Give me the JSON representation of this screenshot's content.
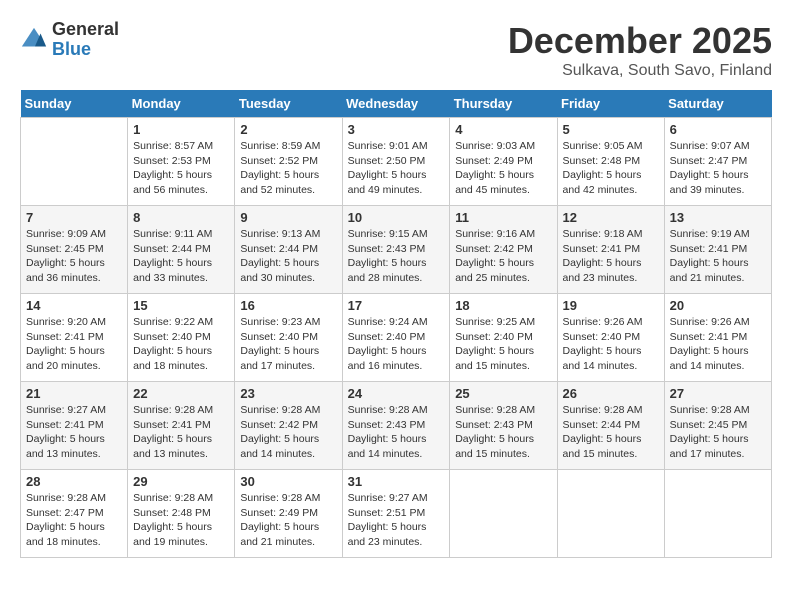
{
  "logo": {
    "general": "General",
    "blue": "Blue"
  },
  "title": "December 2025",
  "location": "Sulkava, South Savo, Finland",
  "header": {
    "days": [
      "Sunday",
      "Monday",
      "Tuesday",
      "Wednesday",
      "Thursday",
      "Friday",
      "Saturday"
    ]
  },
  "weeks": [
    [
      {
        "day": "",
        "info": ""
      },
      {
        "day": "1",
        "info": "Sunrise: 8:57 AM\nSunset: 2:53 PM\nDaylight: 5 hours\nand 56 minutes."
      },
      {
        "day": "2",
        "info": "Sunrise: 8:59 AM\nSunset: 2:52 PM\nDaylight: 5 hours\nand 52 minutes."
      },
      {
        "day": "3",
        "info": "Sunrise: 9:01 AM\nSunset: 2:50 PM\nDaylight: 5 hours\nand 49 minutes."
      },
      {
        "day": "4",
        "info": "Sunrise: 9:03 AM\nSunset: 2:49 PM\nDaylight: 5 hours\nand 45 minutes."
      },
      {
        "day": "5",
        "info": "Sunrise: 9:05 AM\nSunset: 2:48 PM\nDaylight: 5 hours\nand 42 minutes."
      },
      {
        "day": "6",
        "info": "Sunrise: 9:07 AM\nSunset: 2:47 PM\nDaylight: 5 hours\nand 39 minutes."
      }
    ],
    [
      {
        "day": "7",
        "info": "Sunrise: 9:09 AM\nSunset: 2:45 PM\nDaylight: 5 hours\nand 36 minutes."
      },
      {
        "day": "8",
        "info": "Sunrise: 9:11 AM\nSunset: 2:44 PM\nDaylight: 5 hours\nand 33 minutes."
      },
      {
        "day": "9",
        "info": "Sunrise: 9:13 AM\nSunset: 2:44 PM\nDaylight: 5 hours\nand 30 minutes."
      },
      {
        "day": "10",
        "info": "Sunrise: 9:15 AM\nSunset: 2:43 PM\nDaylight: 5 hours\nand 28 minutes."
      },
      {
        "day": "11",
        "info": "Sunrise: 9:16 AM\nSunset: 2:42 PM\nDaylight: 5 hours\nand 25 minutes."
      },
      {
        "day": "12",
        "info": "Sunrise: 9:18 AM\nSunset: 2:41 PM\nDaylight: 5 hours\nand 23 minutes."
      },
      {
        "day": "13",
        "info": "Sunrise: 9:19 AM\nSunset: 2:41 PM\nDaylight: 5 hours\nand 21 minutes."
      }
    ],
    [
      {
        "day": "14",
        "info": "Sunrise: 9:20 AM\nSunset: 2:41 PM\nDaylight: 5 hours\nand 20 minutes."
      },
      {
        "day": "15",
        "info": "Sunrise: 9:22 AM\nSunset: 2:40 PM\nDaylight: 5 hours\nand 18 minutes."
      },
      {
        "day": "16",
        "info": "Sunrise: 9:23 AM\nSunset: 2:40 PM\nDaylight: 5 hours\nand 17 minutes."
      },
      {
        "day": "17",
        "info": "Sunrise: 9:24 AM\nSunset: 2:40 PM\nDaylight: 5 hours\nand 16 minutes."
      },
      {
        "day": "18",
        "info": "Sunrise: 9:25 AM\nSunset: 2:40 PM\nDaylight: 5 hours\nand 15 minutes."
      },
      {
        "day": "19",
        "info": "Sunrise: 9:26 AM\nSunset: 2:40 PM\nDaylight: 5 hours\nand 14 minutes."
      },
      {
        "day": "20",
        "info": "Sunrise: 9:26 AM\nSunset: 2:41 PM\nDaylight: 5 hours\nand 14 minutes."
      }
    ],
    [
      {
        "day": "21",
        "info": "Sunrise: 9:27 AM\nSunset: 2:41 PM\nDaylight: 5 hours\nand 13 minutes."
      },
      {
        "day": "22",
        "info": "Sunrise: 9:28 AM\nSunset: 2:41 PM\nDaylight: 5 hours\nand 13 minutes."
      },
      {
        "day": "23",
        "info": "Sunrise: 9:28 AM\nSunset: 2:42 PM\nDaylight: 5 hours\nand 14 minutes."
      },
      {
        "day": "24",
        "info": "Sunrise: 9:28 AM\nSunset: 2:43 PM\nDaylight: 5 hours\nand 14 minutes."
      },
      {
        "day": "25",
        "info": "Sunrise: 9:28 AM\nSunset: 2:43 PM\nDaylight: 5 hours\nand 15 minutes."
      },
      {
        "day": "26",
        "info": "Sunrise: 9:28 AM\nSunset: 2:44 PM\nDaylight: 5 hours\nand 15 minutes."
      },
      {
        "day": "27",
        "info": "Sunrise: 9:28 AM\nSunset: 2:45 PM\nDaylight: 5 hours\nand 17 minutes."
      }
    ],
    [
      {
        "day": "28",
        "info": "Sunrise: 9:28 AM\nSunset: 2:47 PM\nDaylight: 5 hours\nand 18 minutes."
      },
      {
        "day": "29",
        "info": "Sunrise: 9:28 AM\nSunset: 2:48 PM\nDaylight: 5 hours\nand 19 minutes."
      },
      {
        "day": "30",
        "info": "Sunrise: 9:28 AM\nSunset: 2:49 PM\nDaylight: 5 hours\nand 21 minutes."
      },
      {
        "day": "31",
        "info": "Sunrise: 9:27 AM\nSunset: 2:51 PM\nDaylight: 5 hours\nand 23 minutes."
      },
      {
        "day": "",
        "info": ""
      },
      {
        "day": "",
        "info": ""
      },
      {
        "day": "",
        "info": ""
      }
    ]
  ]
}
